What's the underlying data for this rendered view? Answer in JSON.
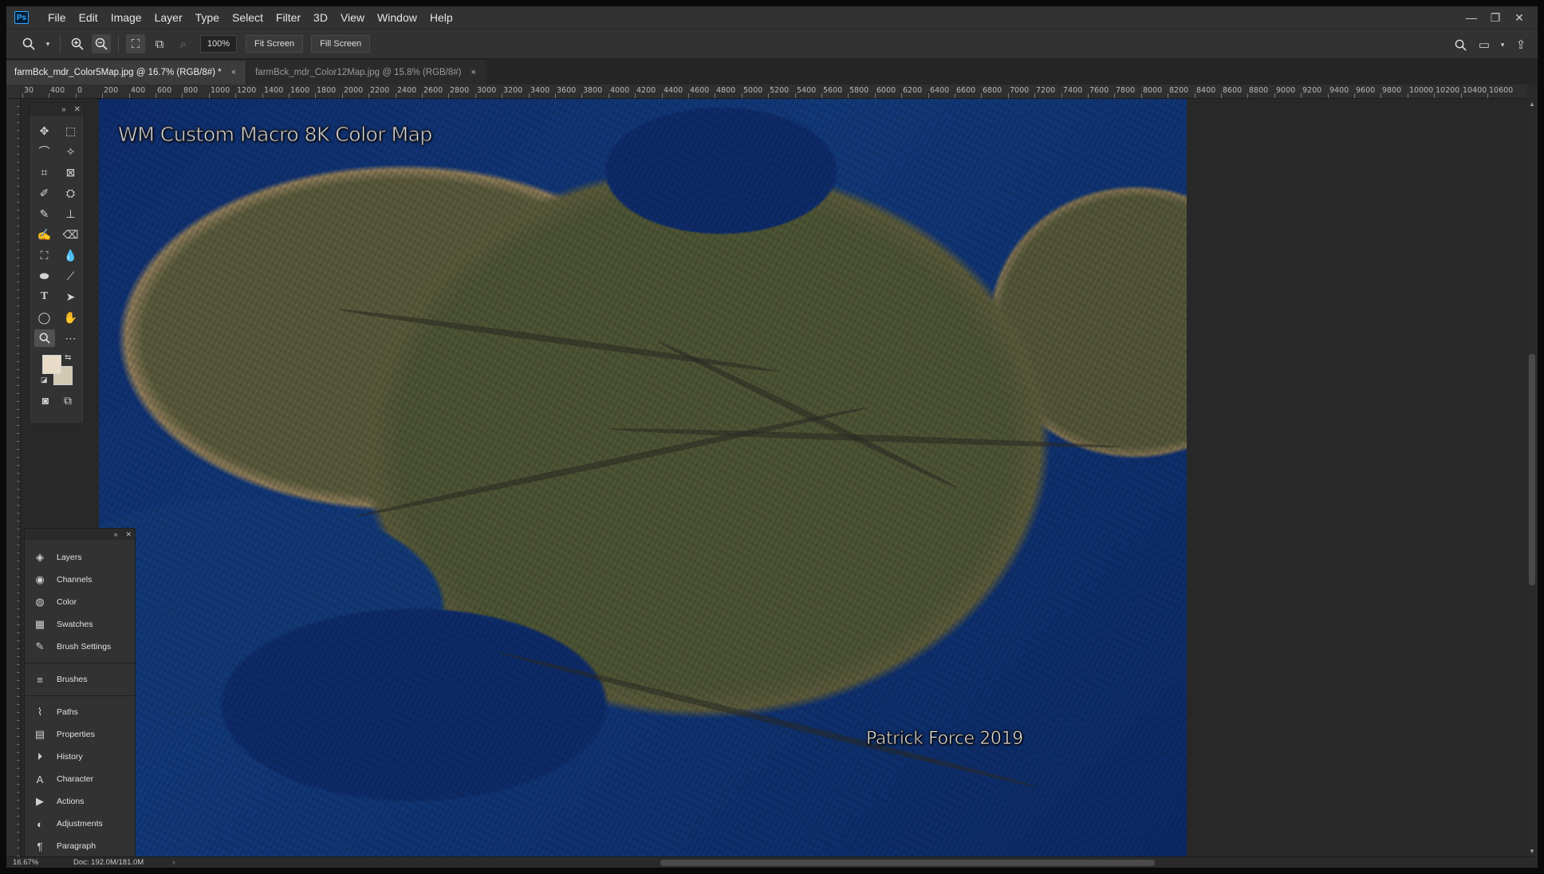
{
  "app": {
    "logo": "Ps"
  },
  "menu": [
    "File",
    "Edit",
    "Image",
    "Layer",
    "Type",
    "Select",
    "Filter",
    "3D",
    "View",
    "Window",
    "Help"
  ],
  "window_controls": {
    "minimize": "—",
    "restore": "❐",
    "close": "✕"
  },
  "options_bar": {
    "zoom_value": "100%",
    "fit_screen": "Fit Screen",
    "fill_screen": "Fill Screen"
  },
  "tabs": [
    {
      "label": "farmBck_mdr_Color5Map.jpg @ 16.7% (RGB/8#) *",
      "close": "×",
      "active": true
    },
    {
      "label": "farmBck_mdr_Color12Map.jpg @ 15.8% (RGB/8#)",
      "close": "×",
      "active": false
    }
  ],
  "ruler_labels": [
    "30",
    "400",
    "0",
    "200",
    "400",
    "600",
    "800",
    "1000",
    "1200",
    "1400",
    "1600",
    "1800",
    "2000",
    "2200",
    "2400",
    "2600",
    "2800",
    "3000",
    "3200",
    "3400",
    "3600",
    "3800",
    "4000",
    "4200",
    "4400",
    "4600",
    "4800",
    "5000",
    "5200",
    "5400",
    "5600",
    "5800",
    "6000",
    "6200",
    "6400",
    "6600",
    "6800",
    "7000",
    "7200",
    "7400",
    "7600",
    "7800",
    "8000",
    "8200",
    "8400",
    "8600",
    "8800",
    "9000",
    "9200",
    "9400",
    "9600",
    "9800",
    "10000",
    "10200",
    "10400",
    "10600"
  ],
  "canvas": {
    "title": "WM Custom Macro 8K Color Map",
    "credit": "Patrick Force 2019"
  },
  "colors": {
    "foreground": "#e8dcc8",
    "background": "#d2c9b3",
    "ocean": "#123a7c",
    "land": "#5a5b3d"
  },
  "panel_items": [
    {
      "label": "Layers",
      "icon": "layers-icon",
      "glyph": "◈"
    },
    {
      "label": "Channels",
      "icon": "channels-icon",
      "glyph": "◉"
    },
    {
      "label": "Color",
      "icon": "color-icon",
      "glyph": "◍"
    },
    {
      "label": "Swatches",
      "icon": "swatches-icon",
      "glyph": "▦"
    },
    {
      "label": "Brush Settings",
      "icon": "brush-settings-icon",
      "glyph": "✎"
    },
    {
      "label": "Brushes",
      "icon": "brushes-icon",
      "glyph": "≡"
    },
    {
      "label": "Paths",
      "icon": "paths-icon",
      "glyph": "⌇"
    },
    {
      "label": "Properties",
      "icon": "properties-icon",
      "glyph": "▤"
    },
    {
      "label": "History",
      "icon": "history-icon",
      "glyph": "⏵"
    },
    {
      "label": "Character",
      "icon": "character-icon",
      "glyph": "A"
    },
    {
      "label": "Actions",
      "icon": "actions-icon",
      "glyph": "▶"
    },
    {
      "label": "Adjustments",
      "icon": "adjustments-icon",
      "glyph": "◐"
    },
    {
      "label": "Paragraph",
      "icon": "paragraph-icon",
      "glyph": "¶"
    }
  ],
  "status": {
    "zoom": "16.67%",
    "doc": "Doc: 192.0M/181.0M",
    "arrow": "›"
  }
}
